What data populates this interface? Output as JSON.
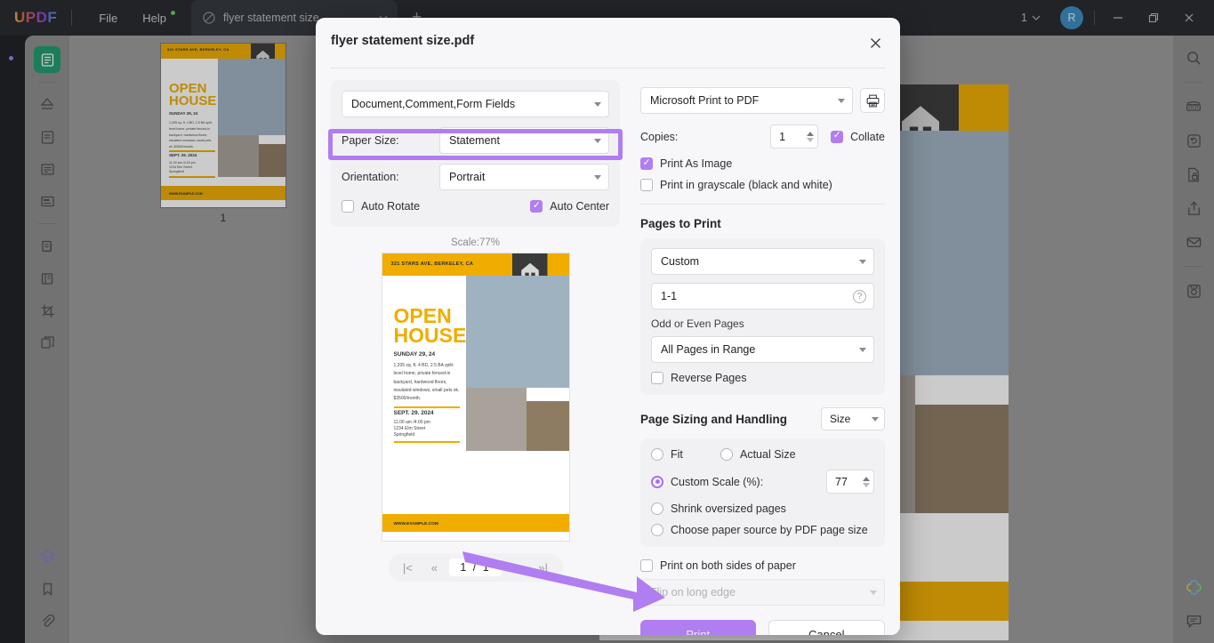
{
  "titlebar": {
    "logo": "UPDF",
    "menus": [
      "File",
      "Help"
    ],
    "tab_name": "flyer statement size",
    "new_tab": "+",
    "zoom_level": "1",
    "avatar_initial": "R"
  },
  "thumbnails": {
    "page_label": "1"
  },
  "dialog": {
    "title": "flyer statement size.pdf",
    "left": {
      "content_select": "Document,Comment,Form Fields",
      "paper_size_label": "Paper Size:",
      "paper_size_value": "Statement",
      "orientation_label": "Orientation:",
      "orientation_value": "Portrait",
      "auto_rotate": "Auto Rotate",
      "auto_rotate_checked": false,
      "auto_center": "Auto Center",
      "auto_center_checked": true,
      "scale_note": "Scale:77%",
      "pager": {
        "first": "|<",
        "prev": "«",
        "value": "1 / 1",
        "next": "»",
        "last": "»|"
      }
    },
    "right": {
      "printer": "Microsoft Print to PDF",
      "copies_label": "Copies:",
      "copies_value": "1",
      "collate_label": "Collate",
      "collate_checked": true,
      "print_as_image_label": "Print As Image",
      "print_as_image_checked": true,
      "grayscale_label": "Print in grayscale (black and white)",
      "grayscale_checked": false,
      "pages_to_print_title": "Pages to Print",
      "pages_mode": "Custom",
      "pages_range": "1-1",
      "odd_even_label": "Odd or Even Pages",
      "odd_even_value": "All Pages in Range",
      "reverse_pages_label": "Reverse Pages",
      "reverse_pages_checked": false,
      "sizing_title": "Page Sizing and Handling",
      "sizing_mode": "Size",
      "fit_label": "Fit",
      "actual_size_label": "Actual Size",
      "custom_scale_label": "Custom Scale (%):",
      "custom_scale_value": "77",
      "shrink_label": "Shrink oversized pages",
      "paper_source_label": "Choose paper source by PDF page size",
      "duplex_label": "Print on both sides of paper",
      "duplex_checked": false,
      "flip_placeholder": "Flip on long edge",
      "print_button": "Print",
      "cancel_button": "Cancel"
    }
  },
  "flyer": {
    "address": "321 STARS AVE, BERKELEY, CA",
    "title_line1": "OPEN",
    "title_line2": "HOUSE",
    "subtitle": "SUNDAY 29, 24",
    "body": "1,205 sq. ft. 4 BD, 2.5 BA split-level home, private fenced-in backyard, hardwood floors, insulated windows, small pets ok. $3500/month.",
    "date": "SEPT. 29. 2024",
    "time": "11.00 am /4.00 pm",
    "street": "1234 Elm Street",
    "city": "Springfield",
    "website": "WWW.EXAMPLE.COM"
  },
  "colors": {
    "accent_purple": "#b07ef0",
    "flyer_yellow": "#f0ad00",
    "flyer_dark": "#3a3a3a",
    "active_green": "#1f9b6e"
  }
}
